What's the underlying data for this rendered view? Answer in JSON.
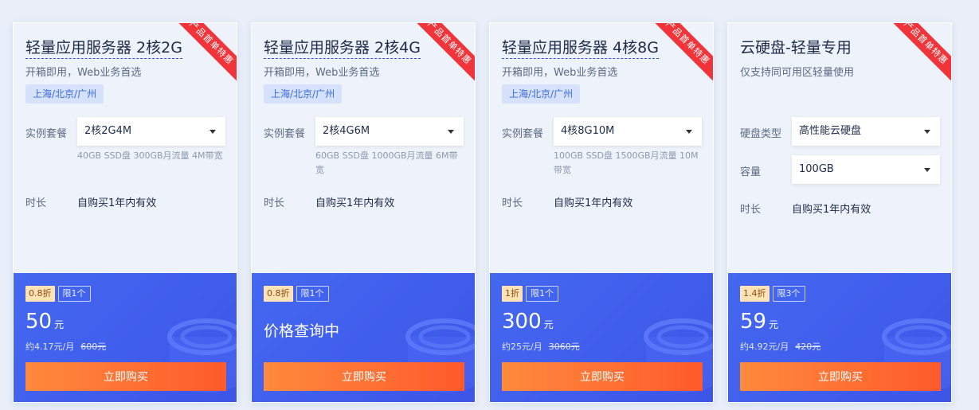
{
  "cards": [
    {
      "ribbon": "产品首单特惠",
      "title": "轻量应用服务器 2核2G",
      "subtitle": "开箱即用，Web业务首选",
      "region": "上海/北京/广州",
      "plan_label": "实例套餐",
      "plan_value": "2核2G4M",
      "plan_desc": "40GB SSD盘 300GB月流量 4M带宽",
      "duration_label": "时长",
      "duration_value": "自购买1年内有效",
      "discount": "0.8折",
      "limit": "限1个",
      "price": "50",
      "price_unit": "元",
      "monthly": "约4.17元/月",
      "original": "600元",
      "buy_label": "立即购买"
    },
    {
      "ribbon": "产品首单特惠",
      "title": "轻量应用服务器 2核4G",
      "subtitle": "开箱即用，Web业务首选",
      "region": "上海/北京/广州",
      "plan_label": "实例套餐",
      "plan_value": "2核4G6M",
      "plan_desc": "60GB SSD盘 1000GB月流量 6M带宽",
      "duration_label": "时长",
      "duration_value": "自购买1年内有效",
      "discount": "0.8折",
      "limit": "限1个",
      "price_text": "价格查询中",
      "buy_label": "立即购买"
    },
    {
      "ribbon": "产品首单特惠",
      "title": "轻量应用服务器 4核8G",
      "subtitle": "开箱即用，Web业务首选",
      "region": "上海/北京/广州",
      "plan_label": "实例套餐",
      "plan_value": "4核8G10M",
      "plan_desc": "100GB SSD盘 1500GB月流量 10M带宽",
      "duration_label": "时长",
      "duration_value": "自购买1年内有效",
      "discount": "1折",
      "limit": "限1个",
      "price": "300",
      "price_unit": "元",
      "monthly": "约25元/月",
      "original": "3060元",
      "buy_label": "立即购买"
    },
    {
      "ribbon": "产品首单特惠",
      "title": "云硬盘-轻量专用",
      "subtitle": "仅支持同可用区轻量使用",
      "disk_type_label": "硬盘类型",
      "disk_type_value": "高性能云硬盘",
      "capacity_label": "容量",
      "capacity_value": "100GB",
      "duration_label": "时长",
      "duration_value": "自购买1年内有效",
      "discount": "1.4折",
      "limit": "限3个",
      "price": "59",
      "price_unit": "元",
      "monthly": "约4.92元/月",
      "original": "420元",
      "buy_label": "立即购买"
    }
  ]
}
